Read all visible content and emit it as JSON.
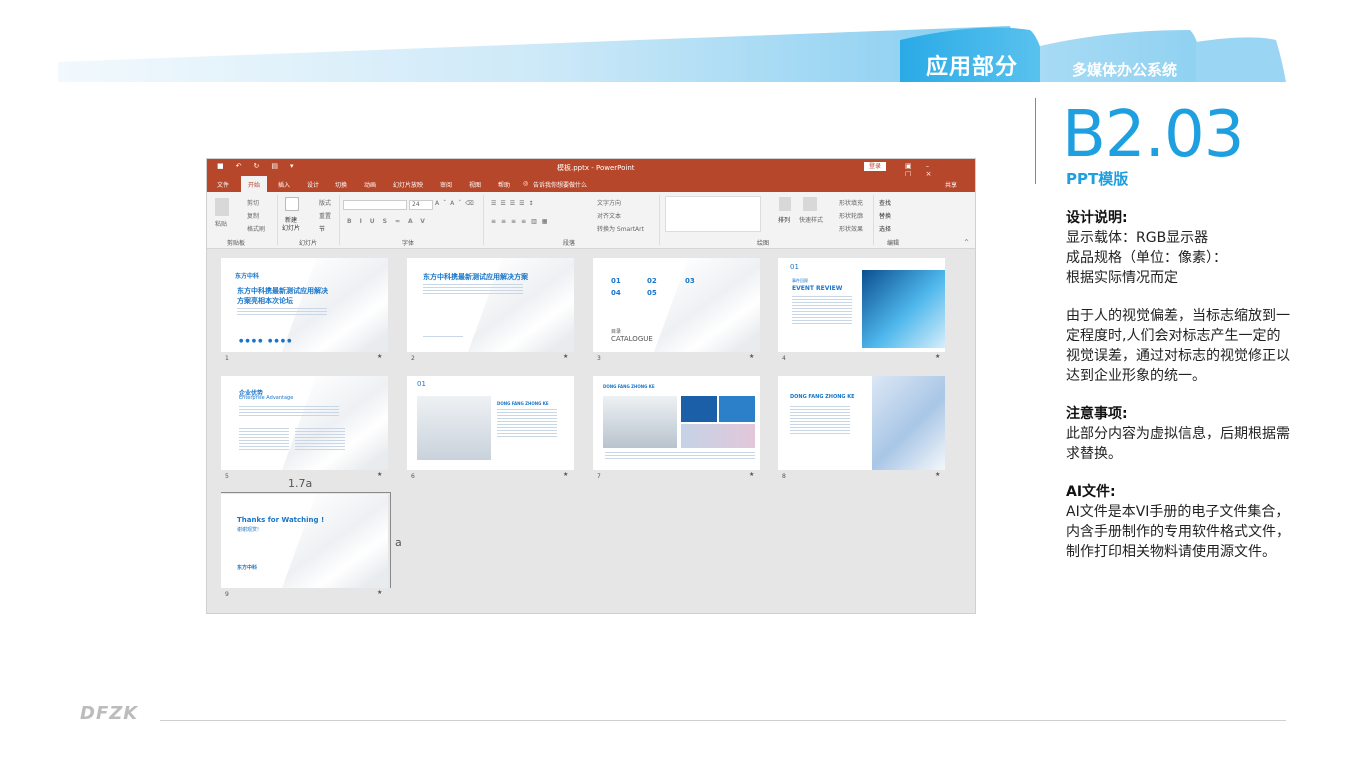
{
  "header": {
    "title": "应用部分",
    "subtitle": "多媒体办公系统"
  },
  "right_panel": {
    "code": "B2.03",
    "code_sub": "PPT模版",
    "design_heading": "设计说明:",
    "design_lines": [
      "显示载体：RGB显示器",
      "成品规格（单位：像素）：",
      "根据实际情况而定"
    ],
    "paragraph": "由于人的视觉偏差，当标志缩放到一定程度时,人们会对标志产生一定的视觉误差，通过对标志的视觉修正以达到企业形象的统一。",
    "notice_heading": "注意事项:",
    "notice_text": "此部分内容为虚拟信息，后期根据需求替换。",
    "ai_heading": "AI文件:",
    "ai_text": "AI文件是本VI手册的电子文件集合，内含手册制作的专用软件格式文件，制作打印相关物料请使用源文件。"
  },
  "footer": {
    "logo": "DFZK"
  },
  "ppt": {
    "title": "模板.pptx - PowerPoint",
    "login": "登录",
    "menu": [
      "文件",
      "开始",
      "插入",
      "设计",
      "切换",
      "动画",
      "幻灯片放映",
      "审阅",
      "视图",
      "帮助"
    ],
    "tell_me": "告诉我你想要做什么",
    "share": "共享",
    "ribbon_groups": [
      "剪贴板",
      "幻灯片",
      "字体",
      "段落",
      "绘图",
      "编辑"
    ],
    "ribbon_labels": {
      "paste": "粘贴",
      "cut": "剪切",
      "copy": "复制",
      "format_painter": "格式刷",
      "new_slide": "新建",
      "new_slide_2": "幻灯片",
      "layout": "版式",
      "reset": "重置",
      "section": "节",
      "font_size": "24",
      "text_direction": "文字方向",
      "align_text": "对齐文本",
      "smartart": "转换为 SmartArt",
      "arrange": "排列",
      "quick_styles": "快速样式",
      "shape_fill": "形状填充",
      "shape_outline": "形状轮廓",
      "shape_effects": "形状效果",
      "find": "查找",
      "replace": "替换",
      "select": "选择"
    },
    "slides": [
      {
        "num": "1",
        "logo": "东方中科",
        "title": "东方中科携最新测试应用解决方案亮相本次论坛"
      },
      {
        "num": "2",
        "title": "东方中科携最新测试应用解决方案"
      },
      {
        "num": "3",
        "items": [
          "01",
          "02",
          "03",
          "04",
          "05"
        ],
        "footer_cn": "目录",
        "footer_en": "CATALOGUE"
      },
      {
        "num": "4",
        "index": "01",
        "cn": "事件回顾",
        "title": "EVENT REVIEW"
      },
      {
        "num": "5",
        "title": "企业优势",
        "sub": "Enterprise Advantage"
      },
      {
        "num": "6",
        "index": "01",
        "title": "DONG FANG ZHONG KE"
      },
      {
        "num": "7",
        "title": "DONG FANG ZHONG KE"
      },
      {
        "num": "8",
        "title": "DONG FANG ZHONG KE"
      },
      {
        "num": "9",
        "title": "Thanks for Watching !",
        "sub": "谢谢观赏!",
        "logo": "东方中科"
      }
    ],
    "dim_width": "1.7a",
    "dim_height": "a"
  },
  "colors": {
    "accent": "#1e9fe0",
    "ppt_red": "#b7472a",
    "banner_light": "#dff1fb"
  }
}
